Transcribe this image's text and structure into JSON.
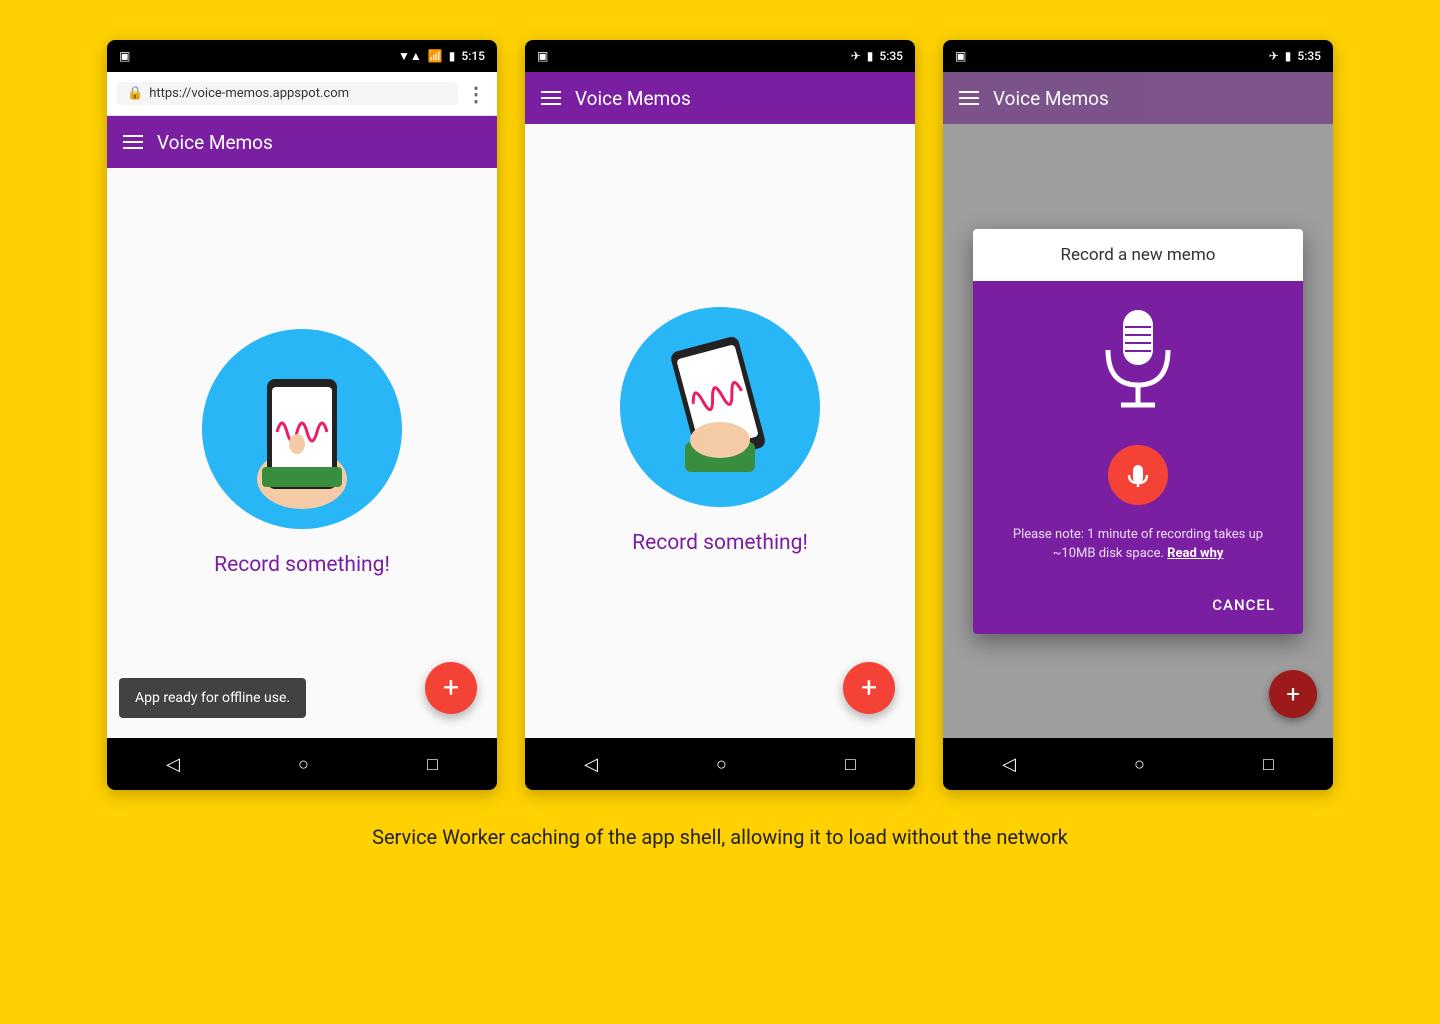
{
  "background_color": "#FFD100",
  "caption": "Service Worker caching of the app shell, allowing it to load without the network",
  "phone1": {
    "status_bar": {
      "time": "5:15",
      "signal_icon": "▼◀",
      "battery_icon": "🔋"
    },
    "browser_bar": {
      "url": "https://voice-memos.appspot.com",
      "menu_icon": "⋮"
    },
    "app_bar": {
      "title": "Voice Memos"
    },
    "content": {
      "record_text": "Record something!"
    },
    "snackbar": {
      "text": "App ready for offline use."
    },
    "fab_label": "+"
  },
  "phone2": {
    "status_bar": {
      "time": "5:35"
    },
    "app_bar": {
      "title": "Voice Memos"
    },
    "content": {
      "record_text": "Record something!"
    },
    "fab_label": "+"
  },
  "phone3": {
    "status_bar": {
      "time": "5:35"
    },
    "app_bar": {
      "title": "Voice Memos"
    },
    "dialog": {
      "title": "Record a new memo",
      "note": "Please note: 1 minute of recording takes up ~10MB disk space.",
      "note_link": "Read why",
      "cancel_button": "CANCEL"
    },
    "fab_label": "+"
  },
  "nav": {
    "back": "◁",
    "home": "○",
    "recent": "□"
  }
}
